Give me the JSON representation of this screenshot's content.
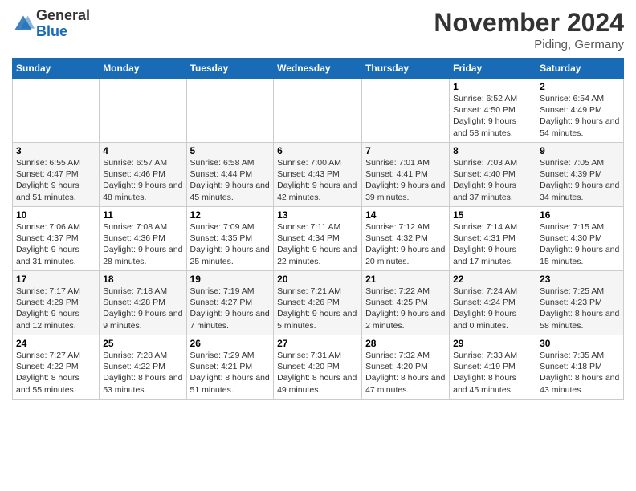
{
  "header": {
    "logo_general": "General",
    "logo_blue": "Blue",
    "title": "November 2024",
    "location": "Piding, Germany"
  },
  "days_of_week": [
    "Sunday",
    "Monday",
    "Tuesday",
    "Wednesday",
    "Thursday",
    "Friday",
    "Saturday"
  ],
  "weeks": [
    [
      {
        "day": "",
        "info": ""
      },
      {
        "day": "",
        "info": ""
      },
      {
        "day": "",
        "info": ""
      },
      {
        "day": "",
        "info": ""
      },
      {
        "day": "",
        "info": ""
      },
      {
        "day": "1",
        "info": "Sunrise: 6:52 AM\nSunset: 4:50 PM\nDaylight: 9 hours and 58 minutes."
      },
      {
        "day": "2",
        "info": "Sunrise: 6:54 AM\nSunset: 4:49 PM\nDaylight: 9 hours and 54 minutes."
      }
    ],
    [
      {
        "day": "3",
        "info": "Sunrise: 6:55 AM\nSunset: 4:47 PM\nDaylight: 9 hours and 51 minutes."
      },
      {
        "day": "4",
        "info": "Sunrise: 6:57 AM\nSunset: 4:46 PM\nDaylight: 9 hours and 48 minutes."
      },
      {
        "day": "5",
        "info": "Sunrise: 6:58 AM\nSunset: 4:44 PM\nDaylight: 9 hours and 45 minutes."
      },
      {
        "day": "6",
        "info": "Sunrise: 7:00 AM\nSunset: 4:43 PM\nDaylight: 9 hours and 42 minutes."
      },
      {
        "day": "7",
        "info": "Sunrise: 7:01 AM\nSunset: 4:41 PM\nDaylight: 9 hours and 39 minutes."
      },
      {
        "day": "8",
        "info": "Sunrise: 7:03 AM\nSunset: 4:40 PM\nDaylight: 9 hours and 37 minutes."
      },
      {
        "day": "9",
        "info": "Sunrise: 7:05 AM\nSunset: 4:39 PM\nDaylight: 9 hours and 34 minutes."
      }
    ],
    [
      {
        "day": "10",
        "info": "Sunrise: 7:06 AM\nSunset: 4:37 PM\nDaylight: 9 hours and 31 minutes."
      },
      {
        "day": "11",
        "info": "Sunrise: 7:08 AM\nSunset: 4:36 PM\nDaylight: 9 hours and 28 minutes."
      },
      {
        "day": "12",
        "info": "Sunrise: 7:09 AM\nSunset: 4:35 PM\nDaylight: 9 hours and 25 minutes."
      },
      {
        "day": "13",
        "info": "Sunrise: 7:11 AM\nSunset: 4:34 PM\nDaylight: 9 hours and 22 minutes."
      },
      {
        "day": "14",
        "info": "Sunrise: 7:12 AM\nSunset: 4:32 PM\nDaylight: 9 hours and 20 minutes."
      },
      {
        "day": "15",
        "info": "Sunrise: 7:14 AM\nSunset: 4:31 PM\nDaylight: 9 hours and 17 minutes."
      },
      {
        "day": "16",
        "info": "Sunrise: 7:15 AM\nSunset: 4:30 PM\nDaylight: 9 hours and 15 minutes."
      }
    ],
    [
      {
        "day": "17",
        "info": "Sunrise: 7:17 AM\nSunset: 4:29 PM\nDaylight: 9 hours and 12 minutes."
      },
      {
        "day": "18",
        "info": "Sunrise: 7:18 AM\nSunset: 4:28 PM\nDaylight: 9 hours and 9 minutes."
      },
      {
        "day": "19",
        "info": "Sunrise: 7:19 AM\nSunset: 4:27 PM\nDaylight: 9 hours and 7 minutes."
      },
      {
        "day": "20",
        "info": "Sunrise: 7:21 AM\nSunset: 4:26 PM\nDaylight: 9 hours and 5 minutes."
      },
      {
        "day": "21",
        "info": "Sunrise: 7:22 AM\nSunset: 4:25 PM\nDaylight: 9 hours and 2 minutes."
      },
      {
        "day": "22",
        "info": "Sunrise: 7:24 AM\nSunset: 4:24 PM\nDaylight: 9 hours and 0 minutes."
      },
      {
        "day": "23",
        "info": "Sunrise: 7:25 AM\nSunset: 4:23 PM\nDaylight: 8 hours and 58 minutes."
      }
    ],
    [
      {
        "day": "24",
        "info": "Sunrise: 7:27 AM\nSunset: 4:22 PM\nDaylight: 8 hours and 55 minutes."
      },
      {
        "day": "25",
        "info": "Sunrise: 7:28 AM\nSunset: 4:22 PM\nDaylight: 8 hours and 53 minutes."
      },
      {
        "day": "26",
        "info": "Sunrise: 7:29 AM\nSunset: 4:21 PM\nDaylight: 8 hours and 51 minutes."
      },
      {
        "day": "27",
        "info": "Sunrise: 7:31 AM\nSunset: 4:20 PM\nDaylight: 8 hours and 49 minutes."
      },
      {
        "day": "28",
        "info": "Sunrise: 7:32 AM\nSunset: 4:20 PM\nDaylight: 8 hours and 47 minutes."
      },
      {
        "day": "29",
        "info": "Sunrise: 7:33 AM\nSunset: 4:19 PM\nDaylight: 8 hours and 45 minutes."
      },
      {
        "day": "30",
        "info": "Sunrise: 7:35 AM\nSunset: 4:18 PM\nDaylight: 8 hours and 43 minutes."
      }
    ]
  ]
}
